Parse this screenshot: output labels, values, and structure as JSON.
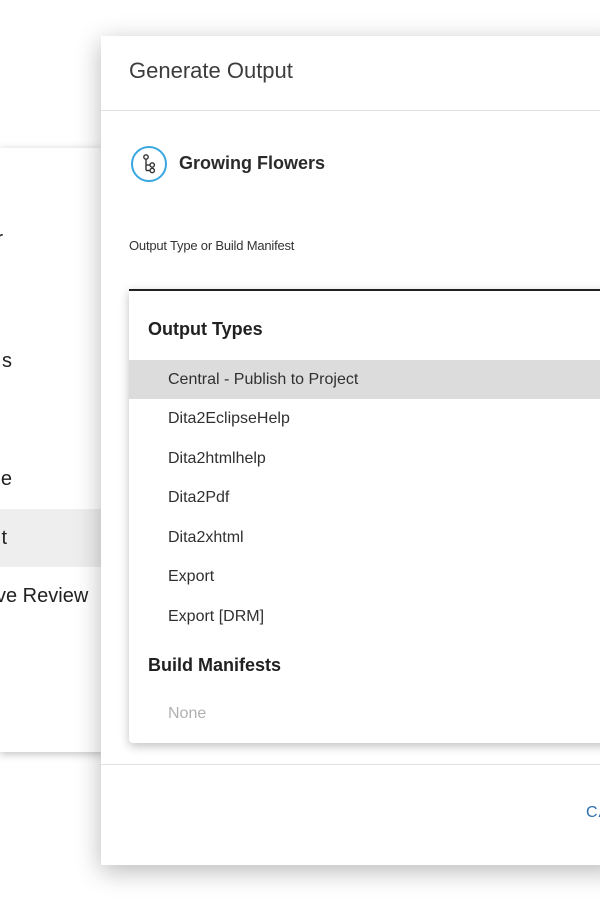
{
  "background_menu": {
    "items": [
      {
        "text": "r"
      },
      {
        "text": "s"
      },
      {
        "text": "e"
      },
      {
        "text": "t"
      },
      {
        "text": "ve Review"
      }
    ]
  },
  "dialog": {
    "title": "Generate Output",
    "project": {
      "name": "Growing Flowers",
      "icon": "hierarchy-icon"
    },
    "field_label": "Output Type or Build Manifest",
    "dropdown": {
      "output_types_header": "Output Types",
      "output_types": [
        "Central - Publish to Project",
        "Dita2EclipseHelp",
        "Dita2htmlhelp",
        "Dita2Pdf",
        "Dita2xhtml",
        "Export",
        "Export [DRM]"
      ],
      "selected_index": 0,
      "build_manifests_header": "Build Manifests",
      "build_manifests": [
        "None"
      ]
    },
    "cancel_label": "CA"
  },
  "colors": {
    "accent_icon": "#39a7e0",
    "cancel_text": "#2f6fae",
    "selected_row": "#dcdcdc"
  }
}
